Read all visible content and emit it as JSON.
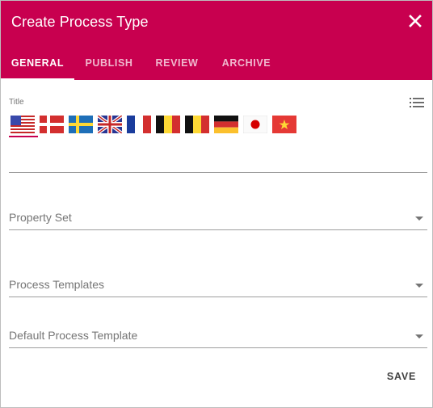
{
  "dialog": {
    "title": "Create Process Type",
    "close_icon": "close-icon",
    "colors": {
      "header": "#c8004f",
      "accent": "#c8004f"
    }
  },
  "tabs": [
    {
      "label": "GENERAL",
      "active": true
    },
    {
      "label": "PUBLISH",
      "active": false
    },
    {
      "label": "REVIEW",
      "active": false
    },
    {
      "label": "ARCHIVE",
      "active": false
    }
  ],
  "title_field": {
    "label": "Title",
    "value": "",
    "list_icon": "list-icon",
    "languages": [
      {
        "flag": "us-flag-icon",
        "selected": true
      },
      {
        "flag": "dk-flag-icon",
        "selected": false
      },
      {
        "flag": "se-flag-icon",
        "selected": false
      },
      {
        "flag": "gb-flag-icon",
        "selected": false
      },
      {
        "flag": "fr-flag-icon",
        "selected": false
      },
      {
        "flag": "be-flag-icon",
        "selected": false
      },
      {
        "flag": "be-flag-icon",
        "selected": false
      },
      {
        "flag": "de-flag-icon",
        "selected": false
      },
      {
        "flag": "jp-flag-icon",
        "selected": false
      },
      {
        "flag": "vn-flag-icon",
        "selected": false
      }
    ]
  },
  "fields": {
    "property_set": {
      "placeholder": "Property Set"
    },
    "process_templates": {
      "placeholder": "Process Templates"
    },
    "default_process_template": {
      "placeholder": "Default Process Template"
    }
  },
  "actions": {
    "save_label": "SAVE"
  }
}
